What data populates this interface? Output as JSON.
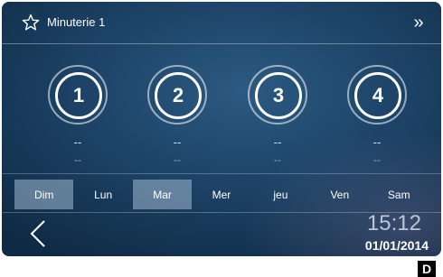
{
  "header": {
    "title": "Minuterie 1",
    "star_icon": "star-outline-icon",
    "forward_icon": "double-chevron-right-icon",
    "forward_glyph": "»"
  },
  "timers": [
    {
      "number": "1",
      "value1": "--",
      "value2": "--"
    },
    {
      "number": "2",
      "value1": "--",
      "value2": "--"
    },
    {
      "number": "3",
      "value1": "--",
      "value2": "--"
    },
    {
      "number": "4",
      "value1": "--",
      "value2": "--"
    }
  ],
  "days": [
    {
      "label": "Dim",
      "active": true
    },
    {
      "label": "Lun",
      "active": false
    },
    {
      "label": "Mar",
      "active": true
    },
    {
      "label": "Mer",
      "active": false
    },
    {
      "label": "jeu",
      "active": false
    },
    {
      "label": "Ven",
      "active": false
    },
    {
      "label": "Sam",
      "active": false
    }
  ],
  "footer": {
    "back_icon": "chevron-left-icon",
    "time": "15:12",
    "date": "01/01/2014"
  },
  "corner_label": "D",
  "colors": {
    "background": "#1d4468",
    "active_day": "#8aa3bd",
    "text": "#ffffff"
  }
}
